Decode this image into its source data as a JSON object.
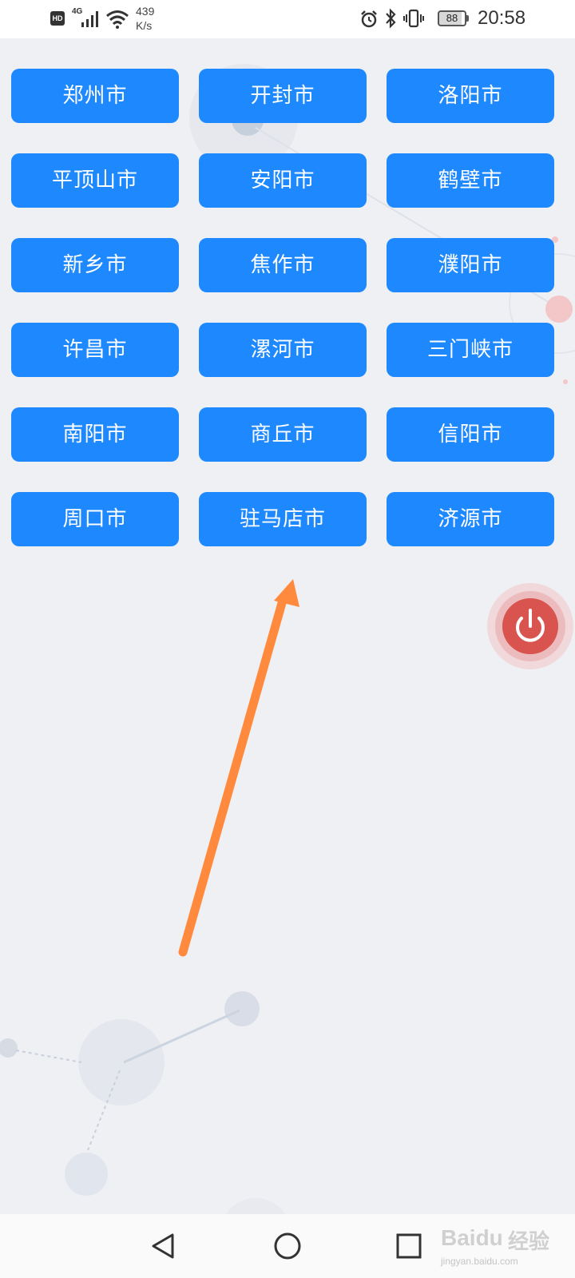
{
  "status_bar": {
    "hd_label": "HD",
    "network_type": "4G",
    "speed_value": "439",
    "speed_unit": "K/s",
    "battery_level": "88",
    "time": "20:58",
    "icons": [
      "hd-icon",
      "signal-icon",
      "wifi-icon",
      "alarm-icon",
      "bluetooth-icon",
      "vibrate-icon",
      "battery-icon"
    ]
  },
  "cities": [
    {
      "label": "郑州市"
    },
    {
      "label": "开封市"
    },
    {
      "label": "洛阳市"
    },
    {
      "label": "平顶山市"
    },
    {
      "label": "安阳市"
    },
    {
      "label": "鹤壁市"
    },
    {
      "label": "新乡市"
    },
    {
      "label": "焦作市"
    },
    {
      "label": "濮阳市"
    },
    {
      "label": "许昌市"
    },
    {
      "label": "漯河市"
    },
    {
      "label": "三门峡市"
    },
    {
      "label": "南阳市"
    },
    {
      "label": "商丘市"
    },
    {
      "label": "信阳市"
    },
    {
      "label": "周口市"
    },
    {
      "label": "驻马店市"
    },
    {
      "label": "济源市"
    }
  ],
  "floating_button": {
    "icon": "power-icon",
    "color": "#d9534f"
  },
  "annotation": {
    "icon": "arrow-up-icon",
    "color": "#ff8a3d"
  },
  "nav_bar": {
    "icons": [
      "back-icon",
      "home-icon",
      "recents-icon"
    ]
  },
  "watermark": {
    "brand": "Baidu",
    "product": "经验",
    "url": "jingyan.baidu.com"
  },
  "colors": {
    "button_blue": "#1e88fe",
    "background": "#eff0f4",
    "annotation_orange": "#ff8a3d",
    "power_red": "#d9534f"
  }
}
